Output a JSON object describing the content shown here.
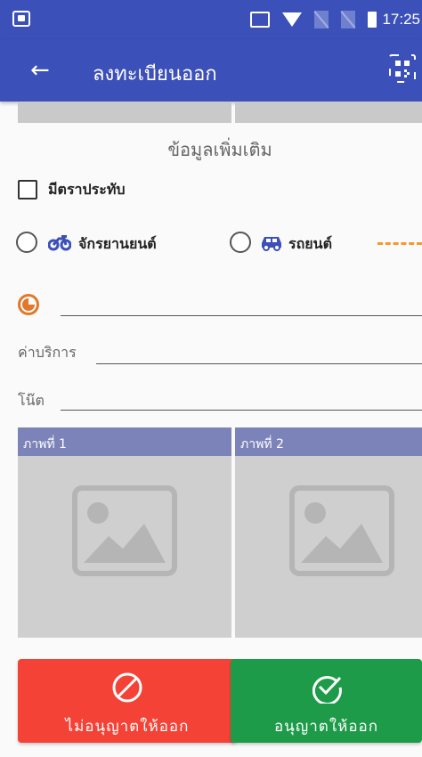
{
  "status_bar": {
    "time": "17:25"
  },
  "app_bar": {
    "title": "ลงทะเบียนออก"
  },
  "section": {
    "title": "ข้อมูลเพิ่มเติม"
  },
  "stamp": {
    "label": "มีตราประทับ",
    "checked": false
  },
  "vehicle": {
    "options": [
      {
        "label": "จักรยานยนต์",
        "selected": false
      },
      {
        "label": "รถยนต์",
        "selected": false
      }
    ]
  },
  "fields": {
    "time_value": "",
    "fee_label": "ค่าบริการ",
    "fee_value": "",
    "note_label": "โน๊ต",
    "note_value": ""
  },
  "photos": [
    {
      "label": "ภาพที่ 1"
    },
    {
      "label": "ภาพที่ 2"
    }
  ],
  "actions": {
    "deny_label": "ไม่อนุญาตให้ออก",
    "allow_label": "อนุญาตให้ออก"
  },
  "colors": {
    "primary": "#3b50b8",
    "deny": "#f44336",
    "allow": "#1e9b48",
    "accent_orange": "#e07a2a",
    "vehicle_icon": "#3b50b8"
  }
}
